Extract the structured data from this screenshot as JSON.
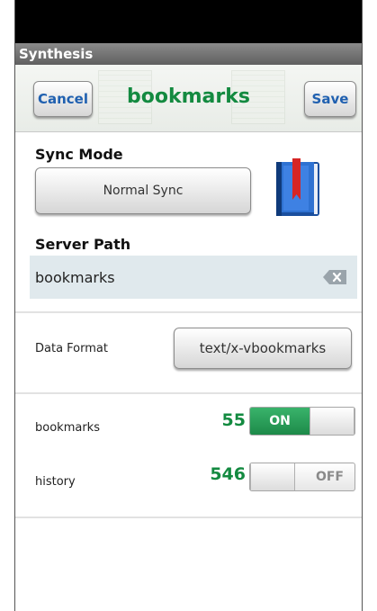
{
  "app": {
    "title": "Synthesis"
  },
  "header": {
    "title": "bookmarks",
    "cancel_label": "Cancel",
    "save_label": "Save"
  },
  "sync": {
    "mode_label": "Sync Mode",
    "mode_value": "Normal Sync"
  },
  "server": {
    "label": "Server Path",
    "value": "bookmarks"
  },
  "data_format": {
    "label": "Data Format",
    "value": "text/x-vbookmarks"
  },
  "collections": [
    {
      "name": "bookmarks",
      "count": "55",
      "toggle_state": "ON"
    },
    {
      "name": "history",
      "count": "546",
      "toggle_state": "OFF"
    }
  ],
  "colors": {
    "accent_green": "#138a40",
    "button_text_blue": "#2060b0",
    "toggle_on": "#1d8a49",
    "field_bg": "#e0e9ed"
  },
  "icons": {
    "sync_icon": "blue-book-icon",
    "clear_field": "clear-text-icon"
  }
}
